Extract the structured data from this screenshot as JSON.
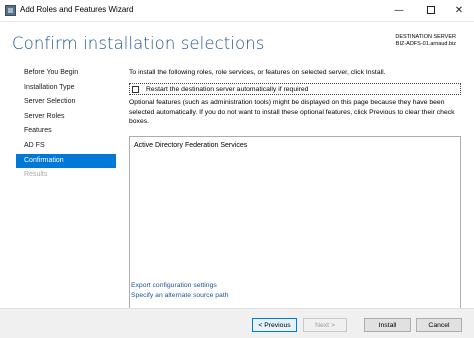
{
  "window": {
    "title": "Add Roles and Features Wizard",
    "minimize_glyph": "—",
    "close_glyph": "✕"
  },
  "header": {
    "page_title": "Confirm installation selections",
    "destination_label": "DESTINATION SERVER",
    "destination_value": "BIZ-ADFS-01.arnaud.biz"
  },
  "nav": {
    "items": [
      {
        "label": "Before You Begin",
        "state": "normal"
      },
      {
        "label": "Installation Type",
        "state": "normal"
      },
      {
        "label": "Server Selection",
        "state": "normal"
      },
      {
        "label": "Server Roles",
        "state": "normal"
      },
      {
        "label": "Features",
        "state": "normal"
      },
      {
        "label": "AD FS",
        "state": "normal"
      },
      {
        "label": "Confirmation",
        "state": "active"
      },
      {
        "label": "Results",
        "state": "disabled"
      }
    ]
  },
  "main": {
    "intro": "To install the following roles, role services, or features on selected server, click Install.",
    "restart_label": "Restart the destination server automatically if required",
    "restart_checked": false,
    "optional_text": "Optional features (such as administration tools) might be displayed on this page because they have been selected automatically. If you do not want to install these optional features, click Previous to clear their check boxes.",
    "selected_items": [
      "Active Directory Federation Services"
    ],
    "links": {
      "export": "Export configuration settings",
      "source": "Specify an alternate source path"
    }
  },
  "footer": {
    "previous": "< Previous",
    "next": "Next >",
    "install": "Install",
    "cancel": "Cancel"
  },
  "colors": {
    "accent": "#0078d7",
    "title_blue": "#1c5496",
    "disabled_text": "#a8a8a8"
  }
}
